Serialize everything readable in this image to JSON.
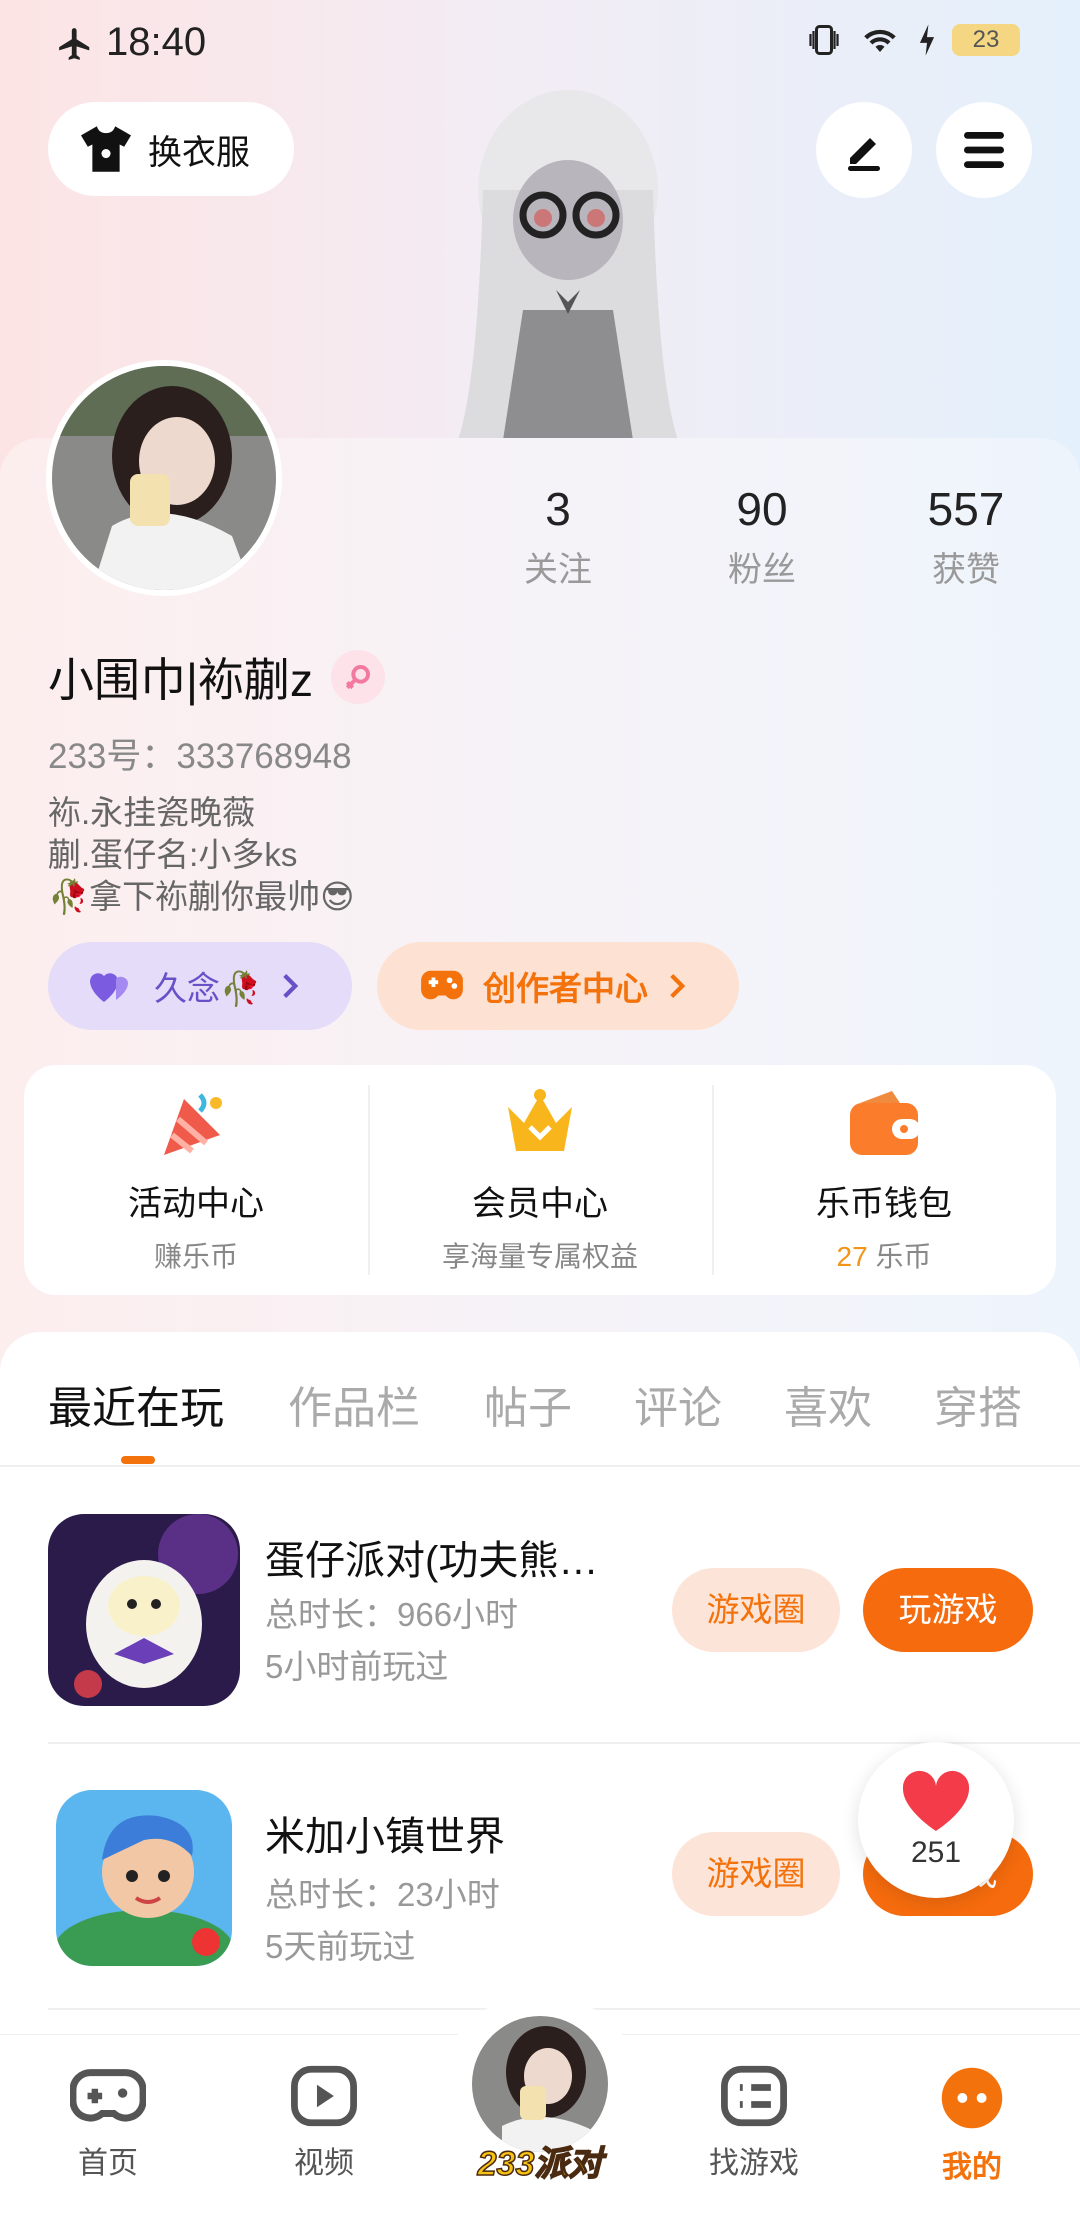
{
  "status": {
    "time": "18:40",
    "battery": "23"
  },
  "header": {
    "outfit_label": "换衣服"
  },
  "stats": [
    {
      "value": "3",
      "label": "关注"
    },
    {
      "value": "90",
      "label": "粉丝"
    },
    {
      "value": "557",
      "label": "获赞"
    }
  ],
  "profile": {
    "name": "小围巾|袮蒯z",
    "uid": "233号：333768948",
    "bio": [
      "袮.永挂瓷晚薇",
      "蒯.蛋仔名:小多ks",
      "🥀拿下袮蒯你最帅😎"
    ]
  },
  "tags": {
    "tag1": "久念🥀",
    "tag2": "创作者中心"
  },
  "features": [
    {
      "title": "活动中心",
      "sub": "赚乐币"
    },
    {
      "title": "会员中心",
      "sub": "享海量专属权益"
    },
    {
      "title": "乐币钱包",
      "amount": "27",
      "unit": " 乐币"
    }
  ],
  "tabs": [
    "最近在玩",
    "作品栏",
    "帖子",
    "评论",
    "喜欢",
    "穿搭"
  ],
  "games": [
    {
      "title": "蛋仔派对(功夫熊…",
      "duration": "总时长：966小时",
      "last": "5小时前玩过",
      "circle": "游戏圈",
      "play": "玩游戏"
    },
    {
      "title": "米加小镇世界",
      "duration": "总时长：23小时",
      "last": "5天前玩过",
      "circle": "游戏圈",
      "play": "玩游戏"
    }
  ],
  "like_count": "251",
  "nav": [
    {
      "label": "首页"
    },
    {
      "label": "视频"
    },
    {
      "label": "233派对"
    },
    {
      "label": "找游戏"
    },
    {
      "label": "我的"
    }
  ],
  "colors": {
    "accent": "#f4720b",
    "play_button": "#f56b0d"
  }
}
